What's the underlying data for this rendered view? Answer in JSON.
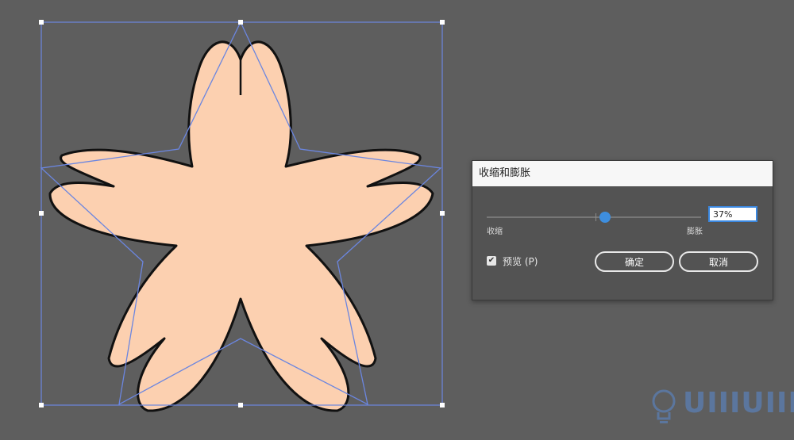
{
  "dialog": {
    "title": "收缩和膨胀",
    "slider": {
      "min_label": "收缩",
      "max_label": "膨胀",
      "value_percent": 37,
      "min_percent": -200,
      "max_percent": 200
    },
    "value_text": "37%",
    "preview_label": "预览 (P)",
    "preview_checked": true,
    "ok_label": "确定",
    "cancel_label": "取消"
  },
  "watermark": {
    "text": "UIIIUIII",
    "subtitle": ""
  },
  "colors": {
    "canvas_bg": "#5e5e5e",
    "shape_fill": "#fcd0b0",
    "shape_stroke": "#111111",
    "selection": "#6b86e0",
    "accent": "#3e8ede"
  }
}
